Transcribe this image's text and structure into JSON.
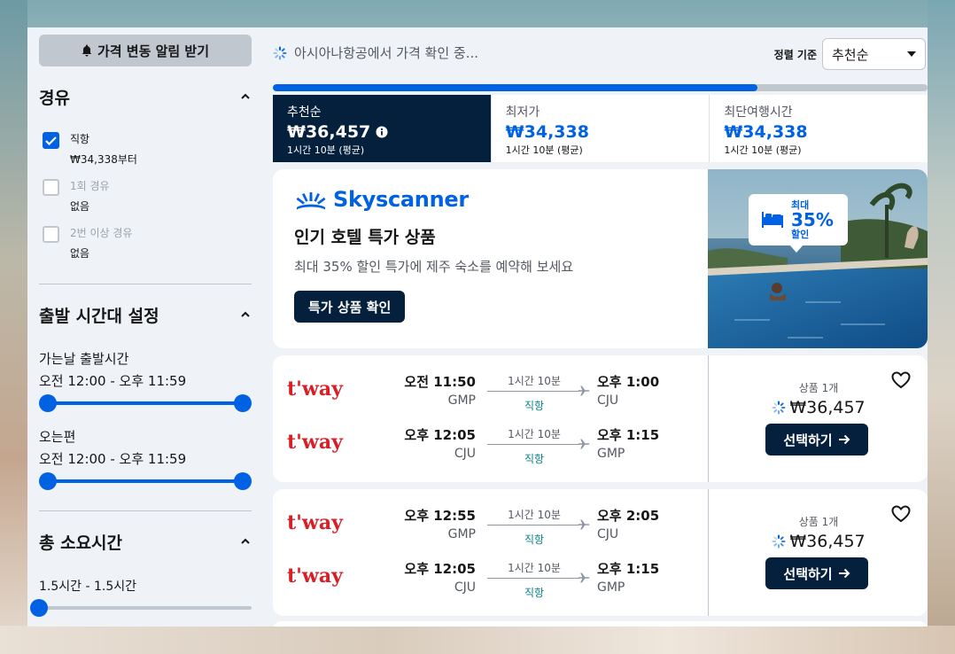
{
  "sidebar": {
    "alert_button": "가격 변동 알림 받기",
    "stops": {
      "title": "경유",
      "options": [
        {
          "label": "직항",
          "sub": "₩34,338부터",
          "checked": true,
          "disabled": false
        },
        {
          "label": "1회 경유",
          "sub": "없음",
          "checked": false,
          "disabled": true
        },
        {
          "label": "2번 이상 경유",
          "sub": "없음",
          "checked": false,
          "disabled": true
        }
      ]
    },
    "departure_times": {
      "title": "출발 시간대 설정",
      "outbound_label": "가는날 출발시간",
      "outbound_range": "오전 12:00 - 오후 11:59",
      "return_label": "오는편",
      "return_range": "오전 12:00 - 오후 11:59"
    },
    "journey_duration": {
      "title": "총 소요시간",
      "range": "1.5시간 - 1.5시간"
    }
  },
  "topbar": {
    "loading_text": "아시아나항공에서 가격 확인 중...",
    "sort_label": "정렬 기준",
    "sort_value": "추천순",
    "progress_percent": 74
  },
  "sort_tabs": [
    {
      "name": "추천순",
      "price": "₩36,457",
      "duration": "1시간 10분 (평균)",
      "active": true
    },
    {
      "name": "최저가",
      "price": "₩34,338",
      "duration": "1시간 10분 (평균)",
      "active": false
    },
    {
      "name": "최단여행시간",
      "price": "₩34,338",
      "duration": "1시간 10분 (평균)",
      "active": false
    }
  ],
  "ad": {
    "brand": "Skyscanner",
    "title": "인기 호텔 특가 상품",
    "description": "최대 35% 할인 특가에 제주 숙소를 예약해 보세요",
    "button": "특가 상품 확인",
    "badge_top": "최대",
    "badge_big": "35%",
    "badge_bottom": "할인"
  },
  "flights": [
    {
      "legs": [
        {
          "airline": "t'way",
          "dep_time": "오전 11:50",
          "dep_code": "GMP",
          "duration": "1시간 10분",
          "stops": "직항",
          "arr_time": "오후 1:00",
          "arr_code": "CJU"
        },
        {
          "airline": "t'way",
          "dep_time": "오후 12:05",
          "dep_code": "CJU",
          "duration": "1시간 10분",
          "stops": "직항",
          "arr_time": "오후 1:15",
          "arr_code": "GMP"
        }
      ],
      "deals": "상품 1개",
      "price": "₩36,457",
      "select": "선택하기"
    },
    {
      "legs": [
        {
          "airline": "t'way",
          "dep_time": "오후 12:55",
          "dep_code": "GMP",
          "duration": "1시간 10분",
          "stops": "직항",
          "arr_time": "오후 2:05",
          "arr_code": "CJU"
        },
        {
          "airline": "t'way",
          "dep_time": "오후 12:05",
          "dep_code": "CJU",
          "duration": "1시간 10분",
          "stops": "직항",
          "arr_time": "오후 1:15",
          "arr_code": "GMP"
        }
      ],
      "deals": "상품 1개",
      "price": "₩36,457",
      "select": "선택하기"
    }
  ],
  "colors": {
    "accent": "#0062e3",
    "dark": "#05203c",
    "direct": "#0c838a",
    "airline_red": "#d81f26"
  }
}
